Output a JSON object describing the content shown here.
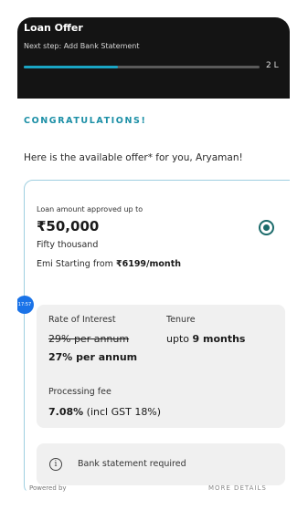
{
  "header": {
    "title": "Loan Offer",
    "subtitle": "Next step: Add Bank Statement",
    "progress_fraction": 0.4,
    "step_count": "2 L"
  },
  "congrats": "CONGRATULATIONS!",
  "intro": "Here is the available offer* for you, Aryaman!",
  "offer": {
    "approved_label": "Loan amount approved up to",
    "amount": "₹50,000",
    "amount_words": "Fifty thousand",
    "emi_prefix": "Emi Starting from",
    "emi_value": "₹6199/month",
    "selected": true,
    "rate_label": "Rate of Interest",
    "old_rate": "29% per annum",
    "new_rate": "27% per annum",
    "tenure_label": "Tenure",
    "tenure_prefix": "upto",
    "tenure_value": "9 months",
    "fee_label": "Processing fee",
    "fee_value": "7.08%",
    "fee_note": "(incl GST 18%)",
    "notice": "Bank statement required"
  },
  "timer_badge": "17:57",
  "footer": {
    "powered_by": "Powered by",
    "more_details": "MORE DETAILS"
  },
  "colors": {
    "accent": "#1b8fa6",
    "progress": "#1aa5c4",
    "radio": "#1c6b6b",
    "card_border": "#9fcfe0",
    "header_bg": "#141414"
  }
}
